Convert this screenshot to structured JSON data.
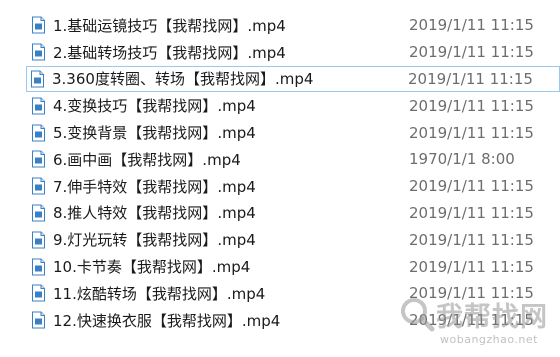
{
  "files": [
    {
      "name": "1.基础运镜技巧【我帮找网】.mp4",
      "date": "2019/1/11 11:15"
    },
    {
      "name": "2.基础转场技巧【我帮找网】.mp4",
      "date": "2019/1/11 11:15"
    },
    {
      "name": "3.360度转圈、转场【我帮找网】.mp4",
      "date": "2019/1/11 11:15",
      "selected": true
    },
    {
      "name": "4.变换技巧【我帮找网】.mp4",
      "date": "2019/1/11 11:15"
    },
    {
      "name": "5.变换背景【我帮找网】.mp4",
      "date": "2019/1/11 11:15"
    },
    {
      "name": "6.画中画【我帮找网】.mp4",
      "date": "1970/1/1 8:00"
    },
    {
      "name": "7.伸手特效【我帮找网】.mp4",
      "date": "2019/1/11 11:15"
    },
    {
      "name": "8.推人特效【我帮找网】.mp4",
      "date": "2019/1/11 11:15"
    },
    {
      "name": "9.灯光玩转【我帮找网】.mp4",
      "date": "2019/1/11 11:15"
    },
    {
      "name": "10.卡节奏【我帮找网】.mp4",
      "date": "2019/1/11 11:15"
    },
    {
      "name": "11.炫酷转场【我帮找网】.mp4",
      "date": "2019/1/11 11:15"
    },
    {
      "name": "12.快速换衣服【我帮找网】.mp4",
      "date": "2019/1/11 11:15"
    }
  ],
  "file_icon": "video-file-icon",
  "selection_border_color": "#99c9ef",
  "watermark": {
    "title": "我帮找网",
    "url": "wobangzhao.net"
  }
}
